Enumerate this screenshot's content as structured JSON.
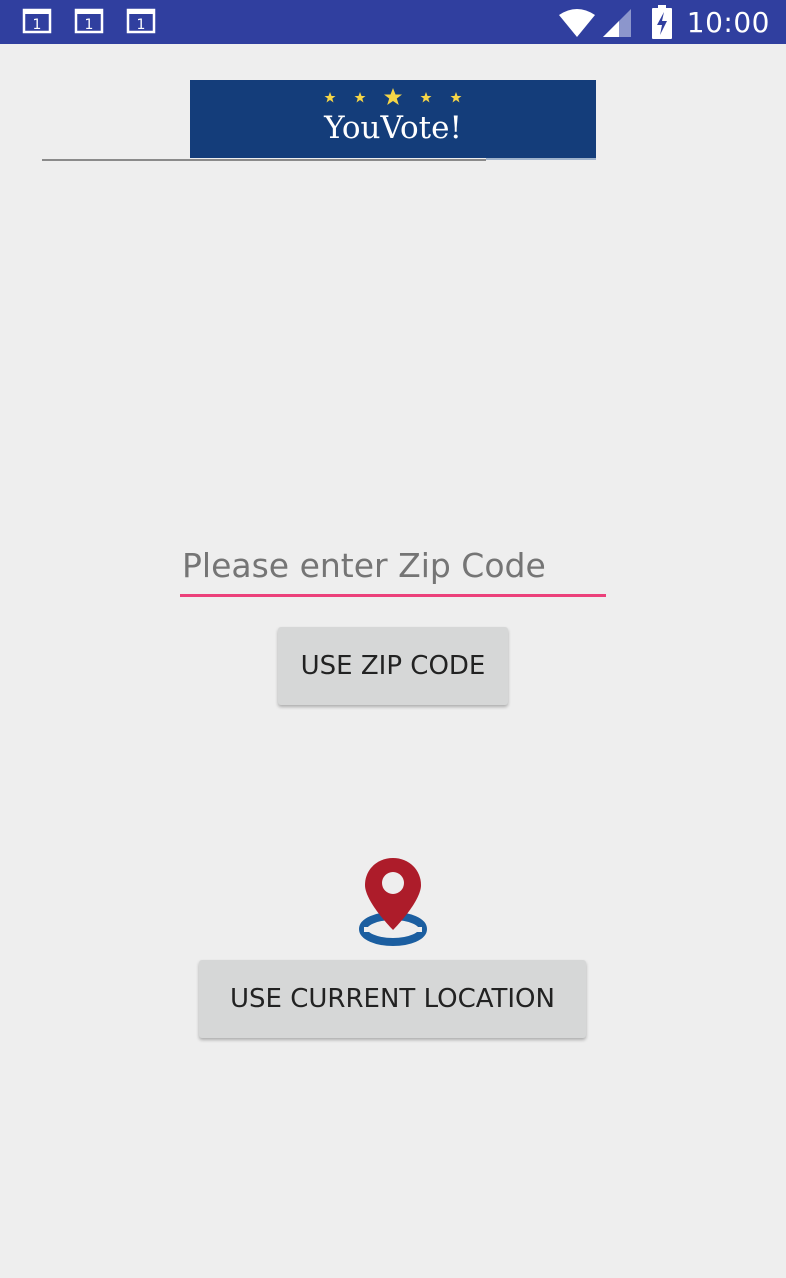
{
  "status_bar": {
    "time": "10:00",
    "notification_icons": [
      "calendar-icon",
      "calendar-icon",
      "calendar-icon"
    ],
    "notification_icon_text": "1",
    "color": "#303f9f"
  },
  "logo": {
    "title": "YouVote!",
    "background_color": "#143d7a",
    "star_color": "#f5d547"
  },
  "zip_input": {
    "placeholder": "Please enter Zip Code",
    "value": "",
    "underline_color": "#ec407a"
  },
  "buttons": {
    "use_zip_code": "USE ZIP CODE",
    "use_current_location": "USE CURRENT LOCATION"
  },
  "icons": {
    "location": "location-pin-icon",
    "pin_color": "#ad1c2a",
    "ring_color": "#1b5ea0"
  }
}
